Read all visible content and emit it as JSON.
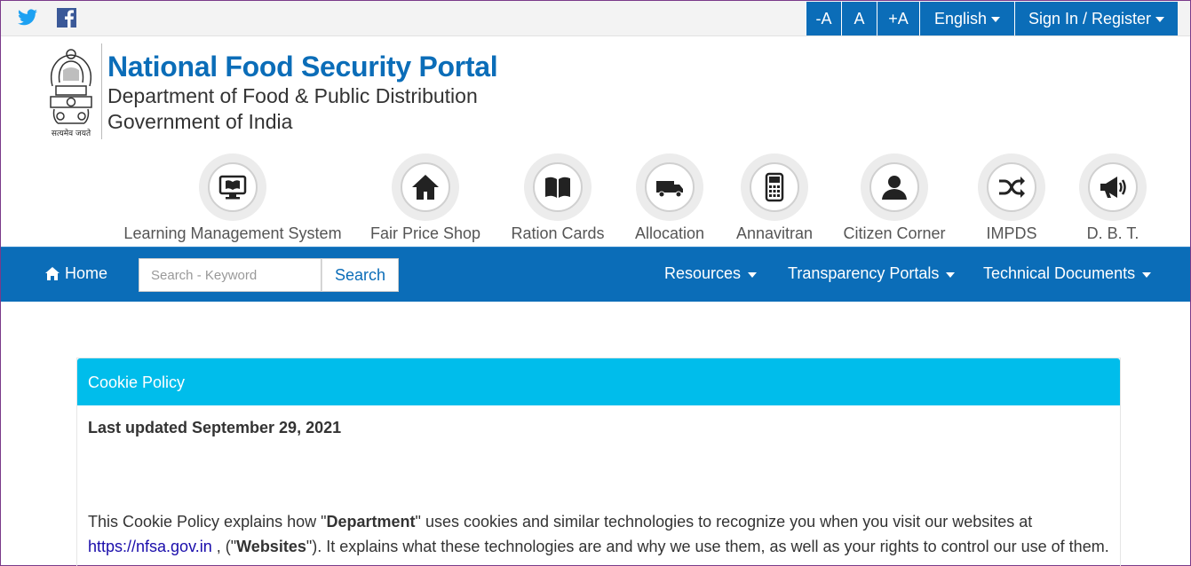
{
  "topbar": {
    "social": [
      {
        "icon": "twitter-icon",
        "color": "#1da1f2"
      },
      {
        "icon": "facebook-icon",
        "color": "#3b5998"
      }
    ],
    "font_smaller": "-A",
    "font_normal": "A",
    "font_larger": "+A",
    "language": "English",
    "sign_in": "Sign In / Register"
  },
  "header": {
    "emblem_motto": "सत्यमेव जयते",
    "title": "National Food Security Portal",
    "subtitle1": "Department of Food & Public Distribution",
    "subtitle2": "Government of India"
  },
  "quick_menu": [
    {
      "label": "Learning Management System",
      "icon": "monitor-book-icon"
    },
    {
      "label": "Fair Price Shop",
      "icon": "house-icon"
    },
    {
      "label": "Ration Cards",
      "icon": "book-icon"
    },
    {
      "label": "Allocation",
      "icon": "truck-icon"
    },
    {
      "label": "Annavitran",
      "icon": "pos-machine-icon"
    },
    {
      "label": "Citizen Corner",
      "icon": "user-icon"
    },
    {
      "label": "IMPDS",
      "icon": "shuffle-icon"
    },
    {
      "label": "D. B. T.",
      "icon": "megaphone-icon"
    }
  ],
  "nav": {
    "home": "Home",
    "search_placeholder": "Search - Keyword",
    "search_button": "Search",
    "menus": [
      "Resources",
      "Transparency Portals",
      "Technical Documents"
    ]
  },
  "content": {
    "heading": "Cookie Policy",
    "updated": "Last updated September 29, 2021",
    "p1_a": "This Cookie Policy explains how \"",
    "p1_b": "Department",
    "p1_c": "\" uses cookies and similar technologies to recognize you when you visit our websites at",
    "p1_link": "https://nfsa.gov.in",
    "p1_d": " , (\"",
    "p1_e": "Websites",
    "p1_f": "\"). It explains what these technologies are and why we use them, as well as your rights to control our use of them."
  },
  "colors": {
    "primary": "#0b6db8",
    "panel_header": "#00bdeb"
  }
}
